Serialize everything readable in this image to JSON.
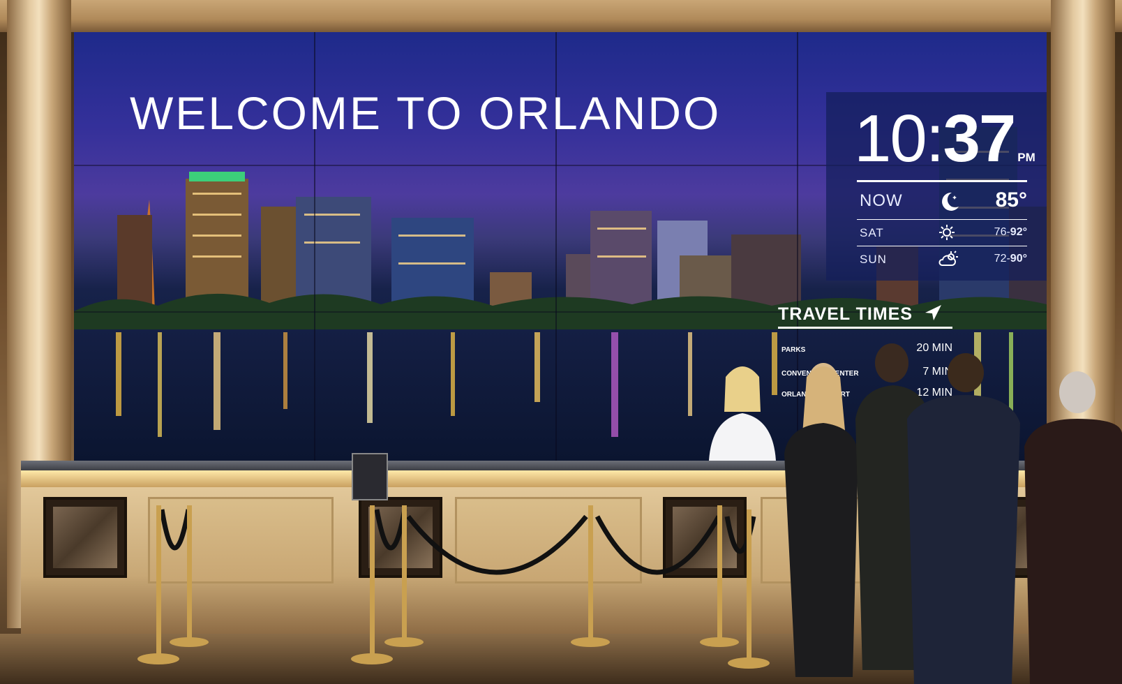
{
  "signage": {
    "headline": "WELCOME TO ORLANDO",
    "clock": {
      "hour": "10",
      "separator": ":",
      "minute": "37",
      "ampm": "PM"
    },
    "weather": {
      "now": {
        "label": "NOW",
        "icon": "moon-stars-icon",
        "temp": "85°"
      },
      "forecast": [
        {
          "day": "SAT",
          "icon": "sun-icon",
          "low": "76",
          "high": "92°"
        },
        {
          "day": "SUN",
          "icon": "partly-cloudy-icon",
          "low": "72",
          "high": "90°"
        }
      ]
    },
    "travel": {
      "title": "TRAVEL TIMES",
      "icon": "navigation-arrow-icon",
      "rows": [
        {
          "name": "PARKS",
          "time": "20 MIN"
        },
        {
          "name": "CONVENTION CENTER",
          "time": "7 MIN"
        },
        {
          "name": "ORLANDO AIRPORT",
          "time": "12 MIN"
        }
      ]
    }
  },
  "colors": {
    "panel": "#141e5a",
    "sky_top": "#1e2a8a",
    "wood": "#c8a876"
  }
}
